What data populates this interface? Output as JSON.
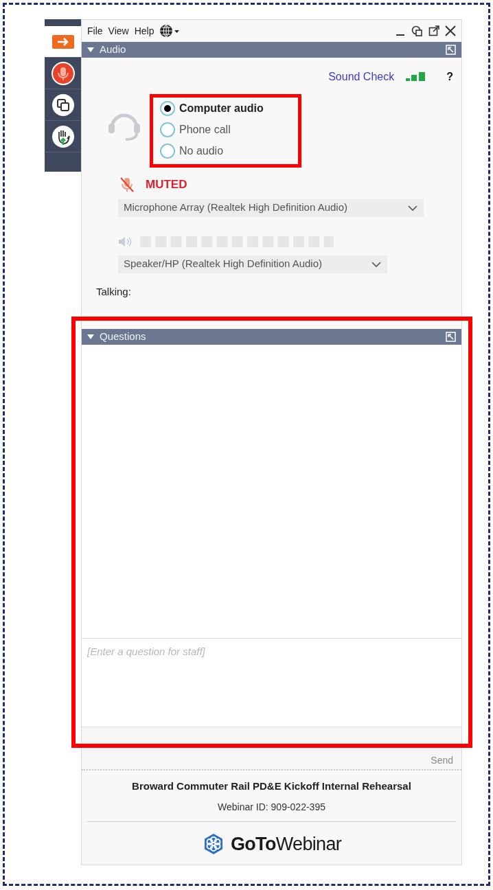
{
  "sidebar": [
    {
      "kind": "arrow",
      "selected": true
    },
    {
      "kind": "mic",
      "selected": false
    },
    {
      "kind": "screens",
      "selected": false
    },
    {
      "kind": "hand",
      "selected": false
    }
  ],
  "menu": [
    "File",
    "View",
    "Help"
  ],
  "audio": {
    "title": "Audio",
    "expanded": true,
    "sound_check": "Sound Check",
    "help": "?",
    "options": [
      {
        "label": "Computer audio",
        "selected": true
      },
      {
        "label": "Phone call",
        "selected": false
      },
      {
        "label": "No audio",
        "selected": false
      }
    ],
    "mute_status": "MUTED",
    "microphone": "Microphone Array (Realtek High Definition Audio)",
    "speaker": "Speaker/HP (Realtek High Definition Audio)",
    "talking_label": "Talking:"
  },
  "questions": {
    "title": "Questions",
    "expanded": true,
    "placeholder": "[Enter a question for staff]",
    "send": "Send",
    "send_disabled": true
  },
  "footer": {
    "webinar_title": "Broward Commuter Rail PD&E Kickoff Internal Rehearsal",
    "webinar_id": "Webinar ID: 909-022-395",
    "brand_bold": "GoTo",
    "brand_rest": "Webinar"
  }
}
